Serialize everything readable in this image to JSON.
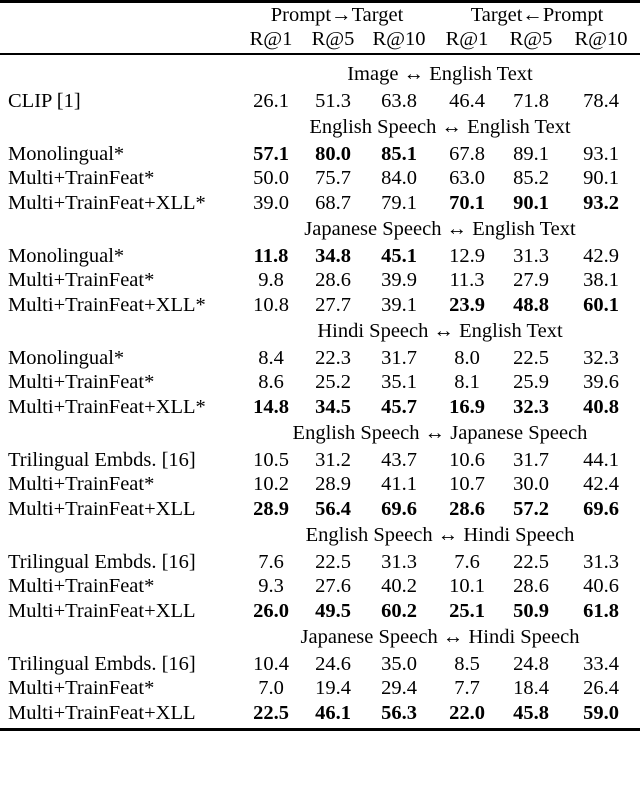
{
  "header": {
    "direction_left": "Prompt→Target",
    "direction_right": "Target←Prompt",
    "metrics": [
      "R@1",
      "R@5",
      "R@10",
      "R@1",
      "R@5",
      "R@10"
    ]
  },
  "sections": [
    {
      "title": "Image ↔ English Text",
      "rows": [
        {
          "label": "CLIP [1]",
          "label_bold": false,
          "values": [
            "26.1",
            "51.3",
            "63.8",
            "46.4",
            "71.8",
            "78.4"
          ],
          "bold": [
            false,
            false,
            false,
            false,
            false,
            false
          ]
        }
      ]
    },
    {
      "title": "English Speech ↔ English Text",
      "rows": [
        {
          "label": "Monolingual*",
          "label_bold": false,
          "values": [
            "57.1",
            "80.0",
            "85.1",
            "67.8",
            "89.1",
            "93.1"
          ],
          "bold": [
            true,
            true,
            true,
            false,
            false,
            false
          ]
        },
        {
          "label": "Multi+TrainFeat*",
          "label_bold": false,
          "values": [
            "50.0",
            "75.7",
            "84.0",
            "63.0",
            "85.2",
            "90.1"
          ],
          "bold": [
            false,
            false,
            false,
            false,
            false,
            false
          ]
        },
        {
          "label": "Multi+TrainFeat+XLL*",
          "label_bold": false,
          "values": [
            "39.0",
            "68.7",
            "79.1",
            "70.1",
            "90.1",
            "93.2"
          ],
          "bold": [
            false,
            false,
            false,
            true,
            true,
            true
          ]
        }
      ]
    },
    {
      "title": "Japanese Speech ↔ English Text",
      "rows": [
        {
          "label": "Monolingual*",
          "label_bold": false,
          "values": [
            "11.8",
            "34.8",
            "45.1",
            "12.9",
            "31.3",
            "42.9"
          ],
          "bold": [
            true,
            true,
            true,
            false,
            false,
            false
          ]
        },
        {
          "label": "Multi+TrainFeat*",
          "label_bold": false,
          "values": [
            "9.8",
            "28.6",
            "39.9",
            "11.3",
            "27.9",
            "38.1"
          ],
          "bold": [
            false,
            false,
            false,
            false,
            false,
            false
          ]
        },
        {
          "label": "Multi+TrainFeat+XLL*",
          "label_bold": false,
          "values": [
            "10.8",
            "27.7",
            "39.1",
            "23.9",
            "48.8",
            "60.1"
          ],
          "bold": [
            false,
            false,
            false,
            true,
            true,
            true
          ]
        }
      ]
    },
    {
      "title": "Hindi Speech ↔ English Text",
      "rows": [
        {
          "label": "Monolingual*",
          "label_bold": false,
          "values": [
            "8.4",
            "22.3",
            "31.7",
            "8.0",
            "22.5",
            "32.3"
          ],
          "bold": [
            false,
            false,
            false,
            false,
            false,
            false
          ]
        },
        {
          "label": "Multi+TrainFeat*",
          "label_bold": false,
          "values": [
            "8.6",
            "25.2",
            "35.1",
            "8.1",
            "25.9",
            "39.6"
          ],
          "bold": [
            false,
            false,
            false,
            false,
            false,
            false
          ]
        },
        {
          "label": "Multi+TrainFeat+XLL*",
          "label_bold": false,
          "values": [
            "14.8",
            "34.5",
            "45.7",
            "16.9",
            "32.3",
            "40.8"
          ],
          "bold": [
            true,
            true,
            true,
            true,
            true,
            true
          ]
        }
      ]
    },
    {
      "title": "English Speech ↔ Japanese Speech",
      "rows": [
        {
          "label": "Trilingual Embds. [16]",
          "label_bold": false,
          "values": [
            "10.5",
            "31.2",
            "43.7",
            "10.6",
            "31.7",
            "44.1"
          ],
          "bold": [
            false,
            false,
            false,
            false,
            false,
            false
          ]
        },
        {
          "label": "Multi+TrainFeat*",
          "label_bold": false,
          "values": [
            "10.2",
            "28.9",
            "41.1",
            "10.7",
            "30.0",
            "42.4"
          ],
          "bold": [
            false,
            false,
            false,
            false,
            false,
            false
          ]
        },
        {
          "label": "Multi+TrainFeat+XLL",
          "label_bold": false,
          "values": [
            "28.9",
            "56.4",
            "69.6",
            "28.6",
            "57.2",
            "69.6"
          ],
          "bold": [
            true,
            true,
            true,
            true,
            true,
            true
          ]
        }
      ]
    },
    {
      "title": "English Speech ↔ Hindi Speech",
      "rows": [
        {
          "label": "Trilingual Embds. [16]",
          "label_bold": false,
          "values": [
            "7.6",
            "22.5",
            "31.3",
            "7.6",
            "22.5",
            "31.3"
          ],
          "bold": [
            false,
            false,
            false,
            false,
            false,
            false
          ]
        },
        {
          "label": "Multi+TrainFeat*",
          "label_bold": false,
          "values": [
            "9.3",
            "27.6",
            "40.2",
            "10.1",
            "28.6",
            "40.6"
          ],
          "bold": [
            false,
            false,
            false,
            false,
            false,
            false
          ]
        },
        {
          "label": "Multi+TrainFeat+XLL",
          "label_bold": false,
          "values": [
            "26.0",
            "49.5",
            "60.2",
            "25.1",
            "50.9",
            "61.8"
          ],
          "bold": [
            true,
            true,
            true,
            true,
            true,
            true
          ]
        }
      ]
    },
    {
      "title": "Japanese Speech ↔ Hindi Speech",
      "rows": [
        {
          "label": "Trilingual Embds. [16]",
          "label_bold": false,
          "values": [
            "10.4",
            "24.6",
            "35.0",
            "8.5",
            "24.8",
            "33.4"
          ],
          "bold": [
            false,
            false,
            false,
            false,
            false,
            false
          ]
        },
        {
          "label": "Multi+TrainFeat*",
          "label_bold": false,
          "values": [
            "7.0",
            "19.4",
            "29.4",
            "7.7",
            "18.4",
            "26.4"
          ],
          "bold": [
            false,
            false,
            false,
            false,
            false,
            false
          ]
        },
        {
          "label": "Multi+TrainFeat+XLL",
          "label_bold": false,
          "values": [
            "22.5",
            "46.1",
            "56.3",
            "22.0",
            "45.8",
            "59.0"
          ],
          "bold": [
            true,
            true,
            true,
            true,
            true,
            true
          ]
        }
      ]
    }
  ]
}
